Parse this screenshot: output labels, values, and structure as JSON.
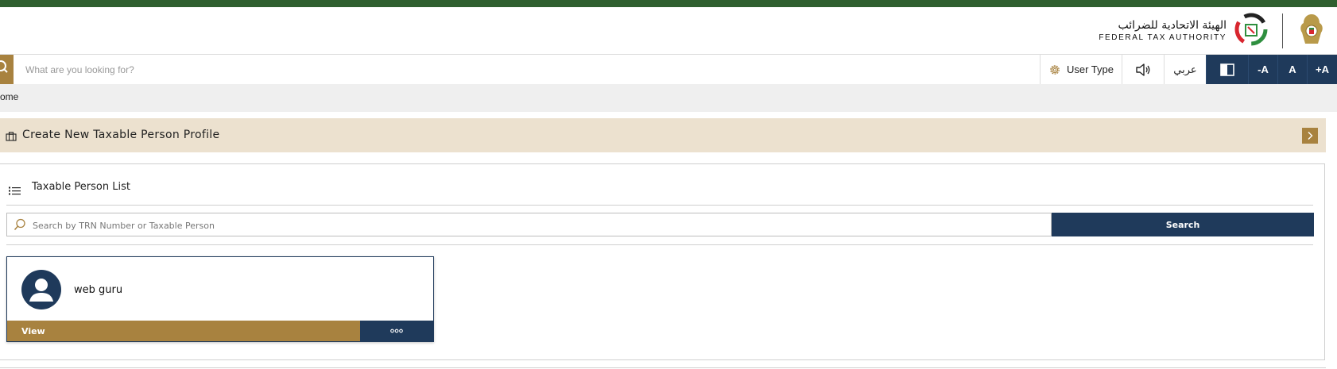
{
  "header": {
    "logo_ar": "الهيئة الاتحادية للضرائب",
    "logo_en": "FEDERAL TAX AUTHORITY"
  },
  "toolbar": {
    "search_placeholder": "What are you looking for?",
    "user_type_label": "User Type",
    "arabic_label": "عربي",
    "decrease_font_label": "-A",
    "normal_font_label": "A",
    "increase_font_label": "+A"
  },
  "breadcrumb": {
    "home_label": "ome"
  },
  "create_profile": {
    "label": "Create New Taxable Person Profile"
  },
  "taxable_list": {
    "title": "Taxable Person List",
    "search_placeholder": "Search by TRN Number or Taxable Person",
    "search_button_label": "Search",
    "cards": [
      {
        "name": "web guru",
        "view_label": "View"
      }
    ]
  },
  "colors": {
    "top_strip": "#2f5f2f",
    "gold": "#a8823f",
    "navy": "#1f3a5b",
    "create_bar_bg": "#ece1cf",
    "breadcrumb_bg": "#efefef"
  }
}
